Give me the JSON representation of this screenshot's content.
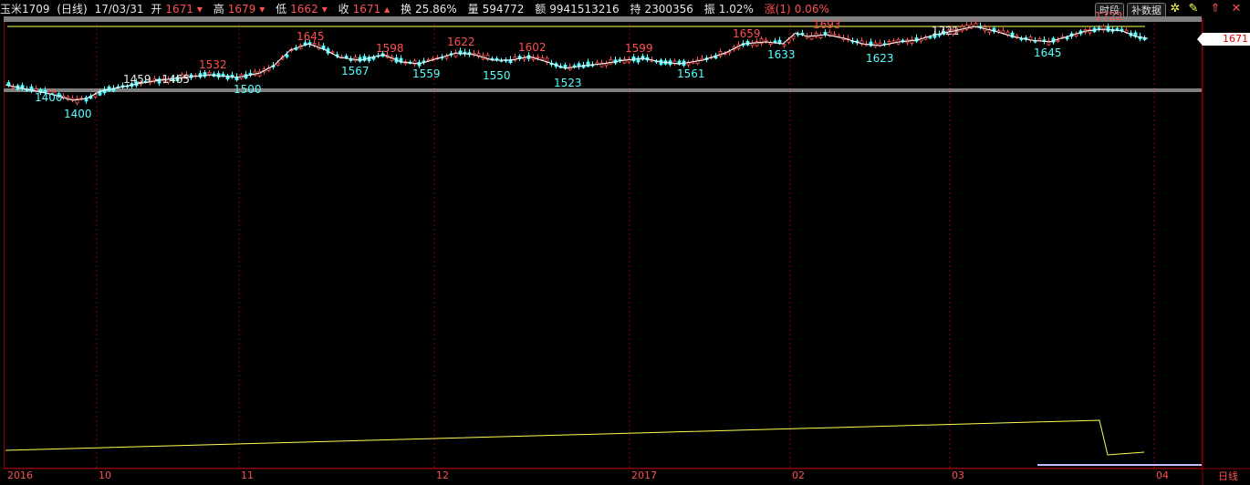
{
  "info": {
    "symbol": "玉米1709",
    "period": "(日线)",
    "date": "17/03/31",
    "open_label": "开",
    "open": "1671",
    "high_label": "高",
    "high": "1679",
    "low_label": "低",
    "low": "1662",
    "close_label": "收",
    "close": "1671",
    "turnover_label": "换",
    "turnover": "25.86%",
    "volume_label": "量",
    "volume": "594772",
    "amount_label": "额",
    "amount": "9941513216",
    "oi_label": "持",
    "oi": "2300356",
    "amplitude_label": "振",
    "amplitude": "1.02%",
    "change_label": "涨(1)",
    "change": "0.06%"
  },
  "toolbar": {
    "time_segment": "时段",
    "supplement_data": "补数据",
    "icons": [
      "gear-icon",
      "pencil-icon",
      "up-arrow-icon",
      "close-icon"
    ]
  },
  "current_price": "1671",
  "colors": {
    "up": "#ff5050",
    "down": "#54ffff",
    "grid": "#8b0000",
    "ma": "#ffffff",
    "lower_line": "#ffff54",
    "band": "#808080"
  },
  "x_axis": {
    "labels": [
      "2016",
      "10",
      "11",
      "12",
      "2017",
      "02",
      "03",
      "04"
    ],
    "period": "日线"
  },
  "annotations": [
    {
      "text": "1400",
      "kind": "low"
    },
    {
      "text": "1400",
      "kind": "low2"
    },
    {
      "text": "1459 - 1465",
      "kind": "range"
    },
    {
      "text": "1532",
      "kind": "high"
    },
    {
      "text": "1500",
      "kind": "low"
    },
    {
      "text": "1645",
      "kind": "high"
    },
    {
      "text": "1567",
      "kind": "low"
    },
    {
      "text": "1598",
      "kind": "high"
    },
    {
      "text": "1559",
      "kind": "low"
    },
    {
      "text": "1622",
      "kind": "high"
    },
    {
      "text": "1550",
      "kind": "low"
    },
    {
      "text": "1602",
      "kind": "high"
    },
    {
      "text": "1523",
      "kind": "low"
    },
    {
      "text": "1599",
      "kind": "high"
    },
    {
      "text": "1561",
      "kind": "low"
    },
    {
      "text": "1659",
      "kind": "high"
    },
    {
      "text": "1633",
      "kind": "low"
    },
    {
      "text": "1693",
      "kind": "high"
    },
    {
      "text": "1623",
      "kind": "low"
    },
    {
      "text": "1721",
      "kind": "white"
    },
    {
      "text": "1645",
      "kind": "low"
    },
    {
      "text": "1722",
      "kind": "high"
    }
  ]
}
